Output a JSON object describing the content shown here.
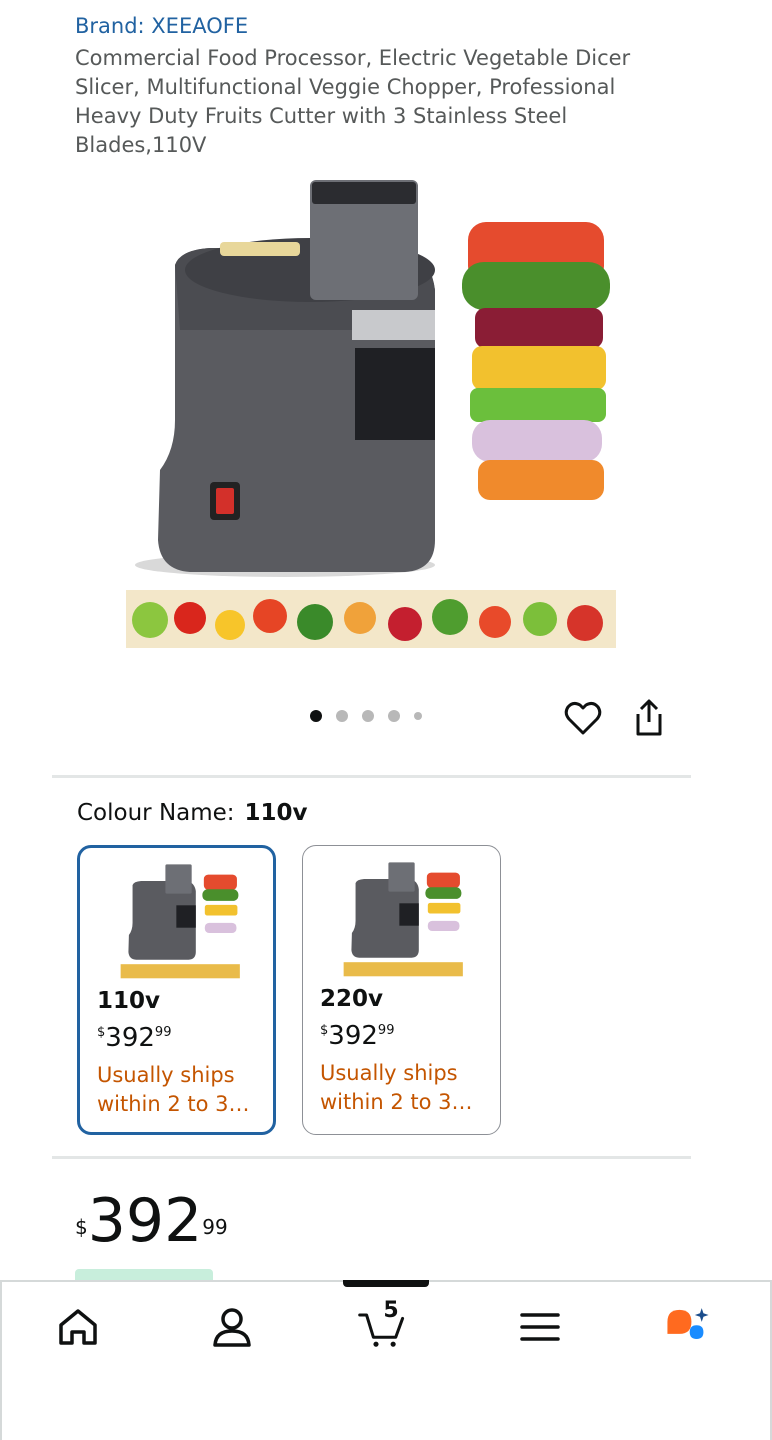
{
  "product": {
    "brand": "Brand: XEEAOFE",
    "title": "Commercial Food Processor, Electric Vegetable Dicer Slicer, Multifunctional Veggie Chopper, Professional Heavy Duty Fruits Cutter with 3 Stainless Steel Blades,110V"
  },
  "gallery": {
    "image_count": 5,
    "active_index": 0
  },
  "variant": {
    "label": "Colour Name:",
    "selected": "110v",
    "options": [
      {
        "name": "110v",
        "price_currency": "$",
        "price_whole": "392",
        "price_fraction": "99",
        "shipping": "Usually ships within 2 to 3…",
        "selected": true
      },
      {
        "name": "220v",
        "price_currency": "$",
        "price_whole": "392",
        "price_fraction": "99",
        "shipping": "Usually ships within 2 to 3…",
        "selected": false
      }
    ]
  },
  "price": {
    "currency": "$",
    "whole": "392",
    "fraction": "99"
  },
  "nav": {
    "cart_count": "5",
    "items": [
      "home-icon",
      "account-icon",
      "cart-icon",
      "menu-icon",
      "rufus-icon"
    ]
  },
  "colors": {
    "link": "#2162a1",
    "shipping": "#c45500",
    "selected_border": "#2162a1"
  }
}
